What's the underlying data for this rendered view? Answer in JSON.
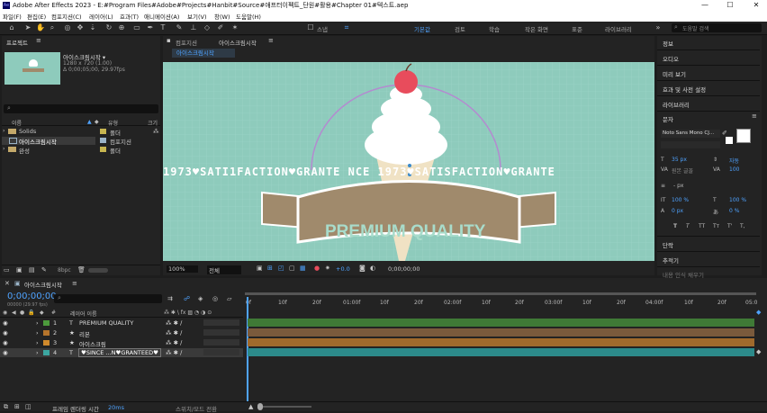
{
  "app": {
    "title": "Adobe After Effects 2023 - E:#Program Files#Adobe#Projects#Hanbit#Source#애프터이펙트_단원#활용#Chapter 01#텍스트.aep",
    "logo": "Ae"
  },
  "window": {
    "min": "—",
    "max": "☐",
    "close": "✕"
  },
  "menu": [
    "파일(F)",
    "편집(E)",
    "컴포지션(C)",
    "레이어(L)",
    "효과(T)",
    "애니메이션(A)",
    "보기(V)",
    "창(W)",
    "도움말(H)"
  ],
  "toolbar": {
    "snap": "스냅",
    "workspaces": [
      "기본값",
      "검토",
      "학습",
      "작은 화면",
      "표준",
      "라이브러리"
    ],
    "search_placeholder": "도움말 검색"
  },
  "project": {
    "tab": "프로젝트",
    "item_name": "아이스크림시작 ▾",
    "item_size": "1280 x 720 (1.00)",
    "item_dur": "Δ 0;00;05;00, 29.97fps",
    "search_placeholder": "⌕",
    "col_name": "이름",
    "col_type": "유형",
    "col_size": "크기",
    "items": [
      {
        "name": "Solids",
        "type": "폴더",
        "color": "#c8b650"
      },
      {
        "name": "아이스크림시작",
        "type": "컴포지션",
        "color": "#9bb4c8"
      },
      {
        "name": "완성",
        "type": "폴더",
        "color": "#c8b650"
      }
    ],
    "bpc": "8bpc"
  },
  "comp": {
    "tab": "컴포지션",
    "tab_name": "아이스크림시작",
    "crumb": "아이스크림시작",
    "zoom": "100%",
    "res": "전체",
    "exposure": "+0.0",
    "time": "0;00;00;00"
  },
  "scene": {
    "ribbon_text": "PREMIUM QUALITY",
    "marquee": "1973♥SATI1FACTION♥GRANTE   NCE 1973♥SATISFACTION♥GRANTE"
  },
  "right": {
    "items": [
      "정보",
      "오디오",
      "미리 보기",
      "효과 및 사전 설정",
      "라이브러리"
    ],
    "text_panel": "문자",
    "font": "Noto Sans Mono CJ...",
    "size": "35 px",
    "leading": "자동",
    "kerning": "원본 글꼴",
    "tracking": "100",
    "stroke": "- px",
    "vscale": "100 %",
    "hscale": "100 %",
    "baseline": "0 px",
    "tsume": "0 %",
    "styles": [
      "T",
      "T",
      "TT",
      "Tᴛ",
      "T'",
      "T,"
    ],
    "para": "단락",
    "align": "추적기",
    "more": "내용 인식 채우기"
  },
  "timeline": {
    "tab": "아이스크림시작",
    "timecode": "0;00;00;00",
    "fps": "00000 (29.97 fps)",
    "search_placeholder": "⌕",
    "col_layer": "레이어 이름",
    "ticks": [
      "0f",
      "10f",
      "20f",
      "01:00f",
      "10f",
      "20f",
      "02:00f",
      "10f",
      "20f",
      "03:00f",
      "10f",
      "20f",
      "04:00f",
      "10f",
      "20f",
      "05:0"
    ],
    "layers": [
      {
        "num": "1",
        "name": "PREMIUM QUALITY",
        "icon": "T",
        "color": "#4c9a3c",
        "bar": "#3f7a36"
      },
      {
        "num": "2",
        "name": "리본",
        "icon": "★",
        "color": "#b4742c",
        "bar": "#8c6a3c"
      },
      {
        "num": "3",
        "name": "아이스크림",
        "icon": "★",
        "color": "#d08a2c",
        "bar": "#a06a2c"
      },
      {
        "num": "4",
        "name": "♥SINCE ...N♥GRANTEED♥",
        "icon": "T",
        "color": "#3ca6a0",
        "bar": "#2c8a8a"
      }
    ],
    "render_label": "프레임 렌더링 시간",
    "render_val": "20ms",
    "toggle": "스위치/모드 전환"
  },
  "colors": {
    "bg": "#8ecbbc",
    "cone": "#f0e2c4",
    "ribbon": "#a08a6c",
    "ribbon_text": "#a8dccb",
    "cherry": "#e84c5c"
  }
}
